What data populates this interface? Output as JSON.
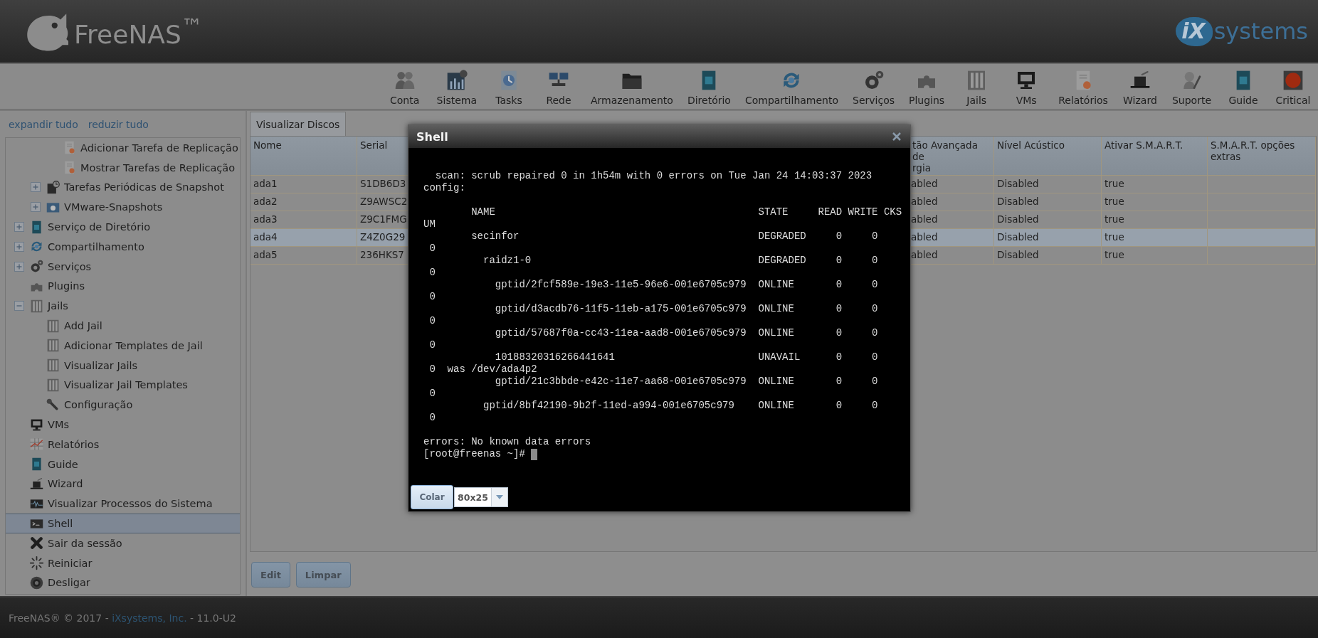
{
  "header": {
    "logo": "FreeNAS$^{™}$",
    "brand_mark": "iX",
    "brand_name": "systems"
  },
  "toolbar": [
    {
      "label": "Conta"
    },
    {
      "label": "Sistema"
    },
    {
      "label": "Tasks"
    },
    {
      "label": "Rede"
    },
    {
      "label": "Armazenamento"
    },
    {
      "label": "Diretório"
    },
    {
      "label": "Compartilhamento"
    },
    {
      "label": "Serviços"
    },
    {
      "label": "Plugins"
    },
    {
      "label": "Jails"
    },
    {
      "label": "VMs"
    },
    {
      "label": "Relatórios"
    },
    {
      "label": "Wizard"
    },
    {
      "label": "Suporte"
    },
    {
      "label": "Guide"
    },
    {
      "label": "Critical"
    }
  ],
  "sidebar": {
    "links": [
      "expandir tudo",
      "reduzir tudo"
    ],
    "tree": [
      {
        "children": [
          {
            "children": [
              {
                "label": "Adicionar Tarefa de Replicação",
                "selected": false
              },
              {
                "label": "Mostrar Tarefas de Replicação",
                "selected": false
              }
            ]
          },
          {
            "label": "Tarefas Periódicas de Snapshot",
            "expanded": false,
            "selected": false
          },
          {
            "label": "VMware-Snapshots",
            "expanded": false,
            "selected": false
          }
        ]
      },
      {
        "label": "Serviço de Diretório",
        "expanded": false,
        "selected": false
      },
      {
        "label": "Compartilhamento",
        "expanded": false,
        "selected": false
      },
      {
        "label": "Serviços",
        "expanded": false,
        "selected": false
      },
      {
        "label": "Plugins",
        "selected": false
      },
      {
        "label": "Jails",
        "expanded": true,
        "selected": false,
        "children": [
          {
            "label": "Add Jail",
            "selected": false
          },
          {
            "label": "Adicionar Templates de Jail",
            "selected": false
          },
          {
            "label": "Visualizar Jails",
            "selected": false
          },
          {
            "label": "Visualizar Jail Templates",
            "selected": false
          },
          {
            "label": "Configuração",
            "selected": false
          }
        ]
      },
      {
        "label": "VMs",
        "selected": false
      },
      {
        "label": "Relatórios",
        "selected": false
      },
      {
        "label": "Guide",
        "selected": false
      },
      {
        "label": "Wizard",
        "selected": false
      },
      {
        "label": "Visualizar Processos do Sistema",
        "selected": false
      },
      {
        "label": "Shell",
        "selected": true
      },
      {
        "label": "Sair da sessão",
        "selected": false
      },
      {
        "label": "Reiniciar",
        "selected": false
      },
      {
        "label": "Desligar",
        "selected": false
      }
    ]
  },
  "tabs": [
    {
      "label": "Visualizar Discos",
      "selected": true
    }
  ],
  "table": {
    "columns": [
      "Nome",
      "Serial",
      "tão Avançada de\nrgia",
      "Nível Acústico",
      "Ativar S.M.A.R.T.",
      "S.M.A.R.T. opções extras"
    ],
    "rows": [
      {
        "cells": [
          "ada1",
          "S1DB6D3",
          "abled",
          "Disabled",
          "true"
        ],
        "selected": false
      },
      {
        "cells": [
          "ada2",
          "Z9AWSC2",
          "abled",
          "Disabled",
          "true"
        ],
        "selected": false
      },
      {
        "cells": [
          "ada3",
          "Z9C1FMG",
          "abled",
          "Disabled",
          "true"
        ],
        "selected": false
      },
      {
        "cells": [
          "ada4",
          "Z4Z0G29",
          "abled",
          "Disabled",
          "true"
        ],
        "selected": true
      },
      {
        "cells": [
          "ada5",
          "236HKS7",
          "abled",
          "Disabled",
          "true"
        ],
        "selected": false
      }
    ]
  },
  "buttons": [
    "Edit",
    "Limpar"
  ],
  "shell": {
    "title": "Shell",
    "output": "  scan: scrub repaired 0 in 1h54m with 0 errors on Tue Jan 24 14:03:37 2023\nconfig:\n\n        NAME                                            STATE     READ WRITE CKS\nUM\n        secinfor                                        DEGRADED     0     0\n 0\n          raidz1-0                                      DEGRADED     0     0\n 0\n            gptid/2fcf589e-19e3-11e5-96e6-001e6705c979  ONLINE       0     0\n 0\n            gptid/d3acdb76-11f5-11eb-a175-001e6705c979  ONLINE       0     0\n 0\n            gptid/57687f0a-cc43-11ea-aad8-001e6705c979  ONLINE       0     0\n 0\n            10188320316266441641                        UNAVAIL      0     0\n 0  was /dev/ada4p2\n            gptid/21c3bbde-e42c-11e7-aa68-001e6705c979  ONLINE       0     0\n 0\n          gptid/8bf42190-9b2f-11ed-a994-001e6705c979    ONLINE       0     0\n 0\n\nerrors: No known data errors",
    "prompt": "[root@freenas ~]#",
    "paste_button": "Colar",
    "size": "80x25"
  },
  "footer": {
    "prefix": "FreeNAS® © 2017 -",
    "link": "iXsystems, Inc.",
    "suffix": "- 11.0-U2"
  }
}
